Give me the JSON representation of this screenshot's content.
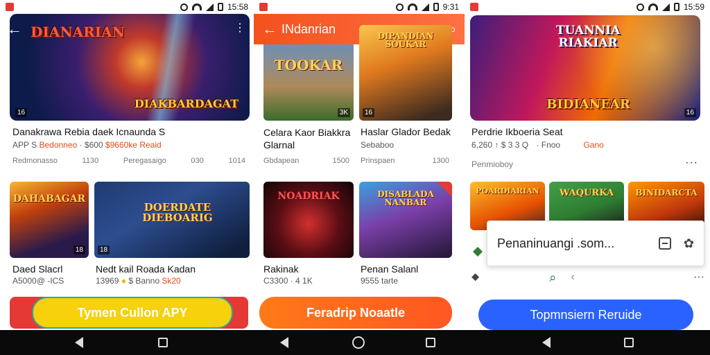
{
  "status": {
    "p1_time": "15:58",
    "p2_time": "9:31",
    "p3_time": "15:59"
  },
  "panel1": {
    "hero_title": "DIANARIAN",
    "hero_logo": "DIAKBARDAGAT",
    "hero_badge": "16",
    "item1": {
      "title": "Danakrawa Rebia  daek Icnaunda S",
      "meta_prefix": "APP S",
      "meta_price": "Bedonneo",
      "meta_mid": "· $600",
      "meta_accent": "$9660ke Reaid",
      "sub_left": "Redmonasso",
      "sub_mid": "1130",
      "sub_right": "Peregasaigo",
      "sub_num": "030",
      "sub_end": "1014"
    },
    "tile1": {
      "logo": "DAHABAGAR",
      "badge": "18"
    },
    "tile2": {
      "logo": "DOERDATE DIEBOARIG",
      "badge": "18"
    },
    "row2": {
      "t1": "Daed Slacrl",
      "m1": "A5000@ -ICS",
      "t2": "Nedt kail Roada Kadan",
      "m2_a": "13969",
      "m2_b": "$ Banno",
      "m2_c": "Sk20"
    },
    "cta_label": "Tymen Cullon APY"
  },
  "panel2": {
    "appbar_title": "INdanrian",
    "tile1": {
      "logo": "TOOKAR",
      "badge": "3K"
    },
    "tile2": {
      "logo": "DIPANDIAN SOUKAR",
      "badge": "16"
    },
    "row1": {
      "t1": "Celara Kaor Biakkra",
      "t1b": "Glarnal",
      "t2": "Haslar Glador Bedak",
      "m2": "Sebaboo",
      "s1": "Gbdapean",
      "s1n": "1500",
      "s2": "Prinspaen",
      "s2n": "1300"
    },
    "tile3": {
      "logo": "NOADRIAK"
    },
    "tile4": {
      "logo": "DISABLADA NANBAR"
    },
    "row2": {
      "t1": "Rakinak",
      "m1": "C3300 · 4 1K",
      "t2": "Penan Salanl",
      "m2": "9555 tarte"
    },
    "cta_label": "Feradrip Noaatle"
  },
  "panel3": {
    "hero_title": "TUANNIA RIAKIAR",
    "hero_logo": "BIDIANEAR",
    "hero_badge": "16",
    "item1": {
      "title": "Perdrie Ikboeria Seat",
      "m_a": "6,260 ↑ $ 3 3 Q",
      "m_b": "· Fnoo",
      "m_c": "Gano"
    },
    "section": "Penmioboy",
    "tiles": [
      "POARDIARIAN",
      "WAQURKA",
      "BINIDARCTA"
    ],
    "popup_text": "Penaninuangi .som...",
    "cta_label": "Topmnsiern Reruide"
  }
}
